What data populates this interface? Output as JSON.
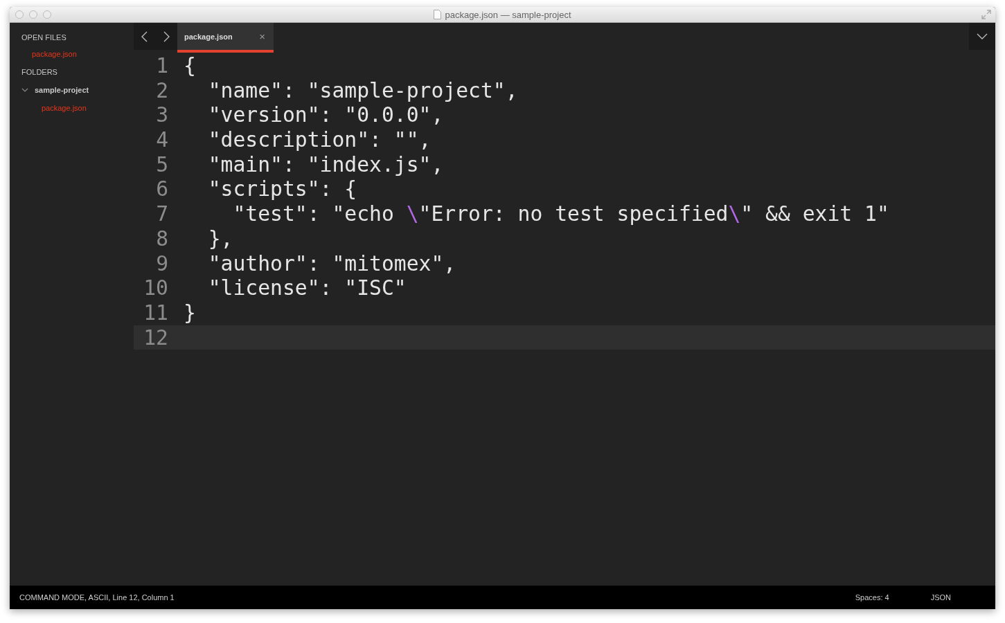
{
  "window": {
    "title": "package.json — sample-project"
  },
  "sidebar": {
    "open_files_heading": "OPEN FILES",
    "open_files": [
      {
        "label": "package.json",
        "selected": true
      }
    ],
    "folders_heading": "FOLDERS",
    "folders": [
      {
        "label": "sample-project",
        "expanded": true,
        "children": [
          {
            "label": "package.json",
            "selected": true
          }
        ]
      }
    ]
  },
  "tabs": [
    {
      "label": "package.json",
      "selected": true,
      "close": "×"
    }
  ],
  "editor": {
    "lines": [
      {
        "number": "1",
        "current": false,
        "segments": [
          {
            "text": "{",
            "kind": "plain"
          }
        ]
      },
      {
        "number": "2",
        "current": false,
        "segments": [
          {
            "text": "  \"name\": \"sample-project\",",
            "kind": "plain"
          }
        ]
      },
      {
        "number": "3",
        "current": false,
        "segments": [
          {
            "text": "  \"version\": \"0.0.0\",",
            "kind": "plain"
          }
        ]
      },
      {
        "number": "4",
        "current": false,
        "segments": [
          {
            "text": "  \"description\": \"\",",
            "kind": "plain"
          }
        ]
      },
      {
        "number": "5",
        "current": false,
        "segments": [
          {
            "text": "  \"main\": \"index.js\",",
            "kind": "plain"
          }
        ]
      },
      {
        "number": "6",
        "current": false,
        "segments": [
          {
            "text": "  \"scripts\": {",
            "kind": "plain"
          }
        ]
      },
      {
        "number": "7",
        "current": false,
        "segments": [
          {
            "text": "    \"test\": \"echo ",
            "kind": "plain"
          },
          {
            "text": "\\",
            "kind": "escape"
          },
          {
            "text": "\"Error: no test specified",
            "kind": "plain"
          },
          {
            "text": "\\",
            "kind": "escape"
          },
          {
            "text": "\" && exit 1\"",
            "kind": "plain"
          }
        ]
      },
      {
        "number": "8",
        "current": false,
        "segments": [
          {
            "text": "  },",
            "kind": "plain"
          }
        ]
      },
      {
        "number": "9",
        "current": false,
        "segments": [
          {
            "text": "  \"author\": \"mitomex\",",
            "kind": "plain"
          }
        ]
      },
      {
        "number": "10",
        "current": false,
        "segments": [
          {
            "text": "  \"license\": \"ISC\"",
            "kind": "plain"
          }
        ]
      },
      {
        "number": "11",
        "current": false,
        "segments": [
          {
            "text": "}",
            "kind": "plain"
          }
        ]
      },
      {
        "number": "12",
        "current": true
      }
    ]
  },
  "status_bar": {
    "left": "COMMAND MODE, ASCII, Line 12, Column 1",
    "spaces": "Spaces: 4",
    "syntax": "JSON"
  }
}
